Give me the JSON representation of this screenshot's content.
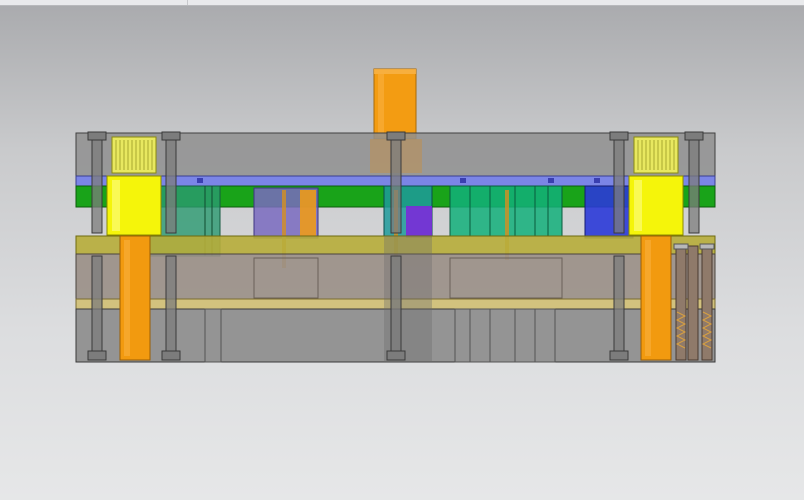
{
  "window": {
    "title": ""
  },
  "viewport": {
    "background_top": "#a9aaad",
    "background_bottom": "#e6e7e8"
  },
  "model": {
    "plates": [
      {
        "name": "top-die-plate",
        "color": "#8f8f8f"
      },
      {
        "name": "backing-plate",
        "color": "#7b85e6"
      },
      {
        "name": "punch-holder-plate",
        "color": "#19a319"
      },
      {
        "name": "stripper-plate",
        "color": "#b7ad3a"
      },
      {
        "name": "die-plate",
        "color": "#9a8f86"
      },
      {
        "name": "die-backing-plate",
        "color": "#d2c27e"
      },
      {
        "name": "bottom-die-plate",
        "color": "#8c8c8c"
      }
    ],
    "components": {
      "shank": {
        "color": "#f29a0f"
      },
      "guide-bushing": {
        "color": "#f5f50a"
      },
      "guide-post": {
        "color": "#f29a0f"
      },
      "punches": [
        "#1fa87a",
        "#7a5bc8",
        "#2b3ad8"
      ]
    }
  }
}
